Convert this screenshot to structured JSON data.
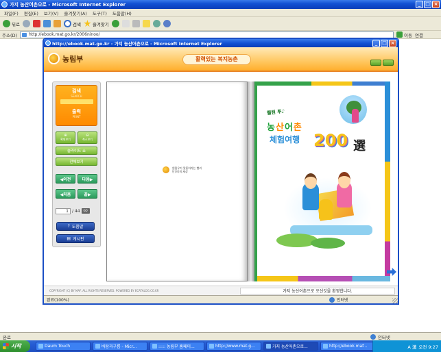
{
  "outer": {
    "title": "가지 농산어촌으로 - Microsoft Internet Explorer",
    "menu": [
      "파일(F)",
      "편집(E)",
      "보기(V)",
      "즐겨찾기(A)",
      "도구(T)",
      "도움말(H)"
    ],
    "toolbar": {
      "back": "뒤로",
      "search": "검색",
      "favorites": "즐겨찾기"
    },
    "address_label": "주소(D)",
    "address_value": "http://ebook.mat.go.kr/2006ninoo/",
    "go_label": "이동",
    "links_label": "연결",
    "status_left": "완료",
    "status_zone": "인터넷"
  },
  "taskbar": {
    "start": "시작",
    "items": [
      "Daum Touch",
      "바탕과구름 - Micr...",
      "::::: 농림부 홈페이...",
      "http://www.mat.g...",
      "가지 농산어촌으로...",
      "http://ebook.maf..."
    ],
    "active_index": 4,
    "clock": "오전 9:27",
    "ime": "A 漢"
  },
  "popup": {
    "title": "http://ebook.mat.go.kr - 가지 농산어촌으로 - Microsoft Internet Explorer",
    "brand": "농림부",
    "slogan": "활력있는 복지농촌",
    "panel": {
      "search_label": "검색",
      "search_sub": "SEARCH",
      "print_label": "출력",
      "print_sub": "PRINT",
      "zoom_in": "확대보기",
      "zoom_out": "축소보기",
      "slideshow": "슬라이드 쇼",
      "full_view": "전체보기",
      "prev": "◀이전",
      "next": "다음▶",
      "first": "◀처음",
      "last": "끝▶",
      "page_current": "1",
      "page_total": "/ 44",
      "go": "GO",
      "help": "도움말",
      "board": "게시판"
    },
    "left_page_caption": "원림우기 맛좋아가는 행리단(으)의 세상",
    "cover": {
      "pre": "웰컴 투♪",
      "title_line1_parts": [
        "농",
        "산",
        "어",
        "촌"
      ],
      "title_line2": "체험여행",
      "number": "200",
      "hanja": "選"
    },
    "footer_copy": "COPYRIGHT (C) BY MAF. ALL RIGHTS RESERVED. POWERED BY ECATALOG.CO.KR",
    "footer_notice": "가지 농산어촌으로 오신것을 환영합니다.",
    "status_left": "완료(100%)",
    "status_zone": "인터넷"
  },
  "colors": {
    "xp_blue": "#0a3db8",
    "brand_orange": "#ffae2c",
    "panel_green": "#77b732",
    "panel_teal": "#2b9a5c",
    "panel_navy": "#1a3d94"
  }
}
